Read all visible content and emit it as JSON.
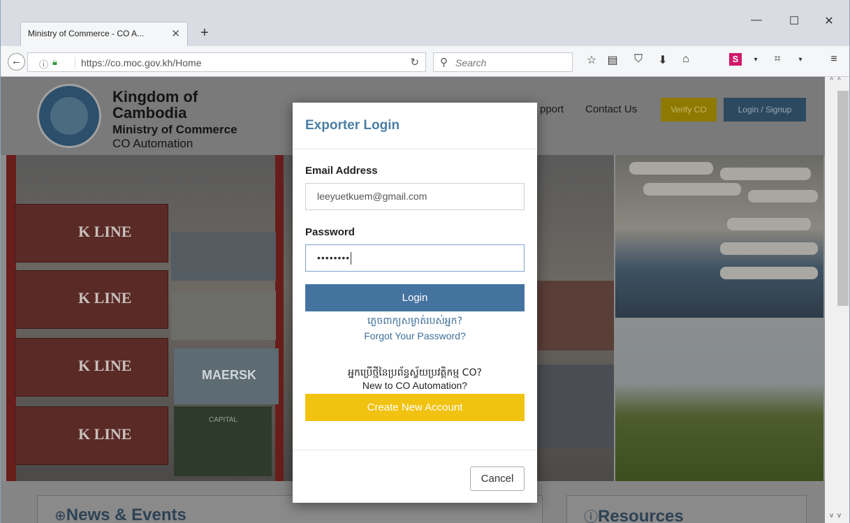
{
  "browser": {
    "tab_title": "Ministry of Commerce - CO A...",
    "tab_close": "✕",
    "new_tab": "+",
    "minimize": "—",
    "maximize": "☐",
    "close": "✕",
    "url": "https://co.moc.gov.kh/Home",
    "search_placeholder": "Search"
  },
  "site": {
    "brand_line1": "Kingdom of",
    "brand_line2": "Cambodia",
    "brand_line3": "Ministry of Commerce",
    "brand_line4": "CO Automation",
    "nav_support": "pport",
    "nav_contact": "Contact Us",
    "verify_label": "Verify CO",
    "login_signup_label": "Login / Signup",
    "container_label": "K LINE",
    "maersk_label": "MAERSK",
    "capital_label": "CAPITAL",
    "news_title": "News & Events",
    "resources_title": "Resources"
  },
  "modal": {
    "title": "Exporter Login",
    "email_label": "Email Address",
    "email_value": "leeyuetkuem@gmail.com",
    "password_label": "Password",
    "password_value": "••••••••",
    "login_label": "Login",
    "forgot_khmer": "ភ្លេចពាក្យសម្ងាត់របស់អ្នក?",
    "forgot_english": "Forgot Your Password?",
    "new_khmer": "អ្នកប្រើថ្មីនៃប្រព័ន្ធស្វ័យប្រវត្តិកម្ម CO?",
    "new_english": "New to CO Automation?",
    "create_label": "Create New Account",
    "cancel_label": "Cancel"
  },
  "colors": {
    "modal_title": "#4b7ea5",
    "login_button": "#4573a0",
    "create_button": "#f1c20f",
    "verify_button": "#8e7a00"
  }
}
